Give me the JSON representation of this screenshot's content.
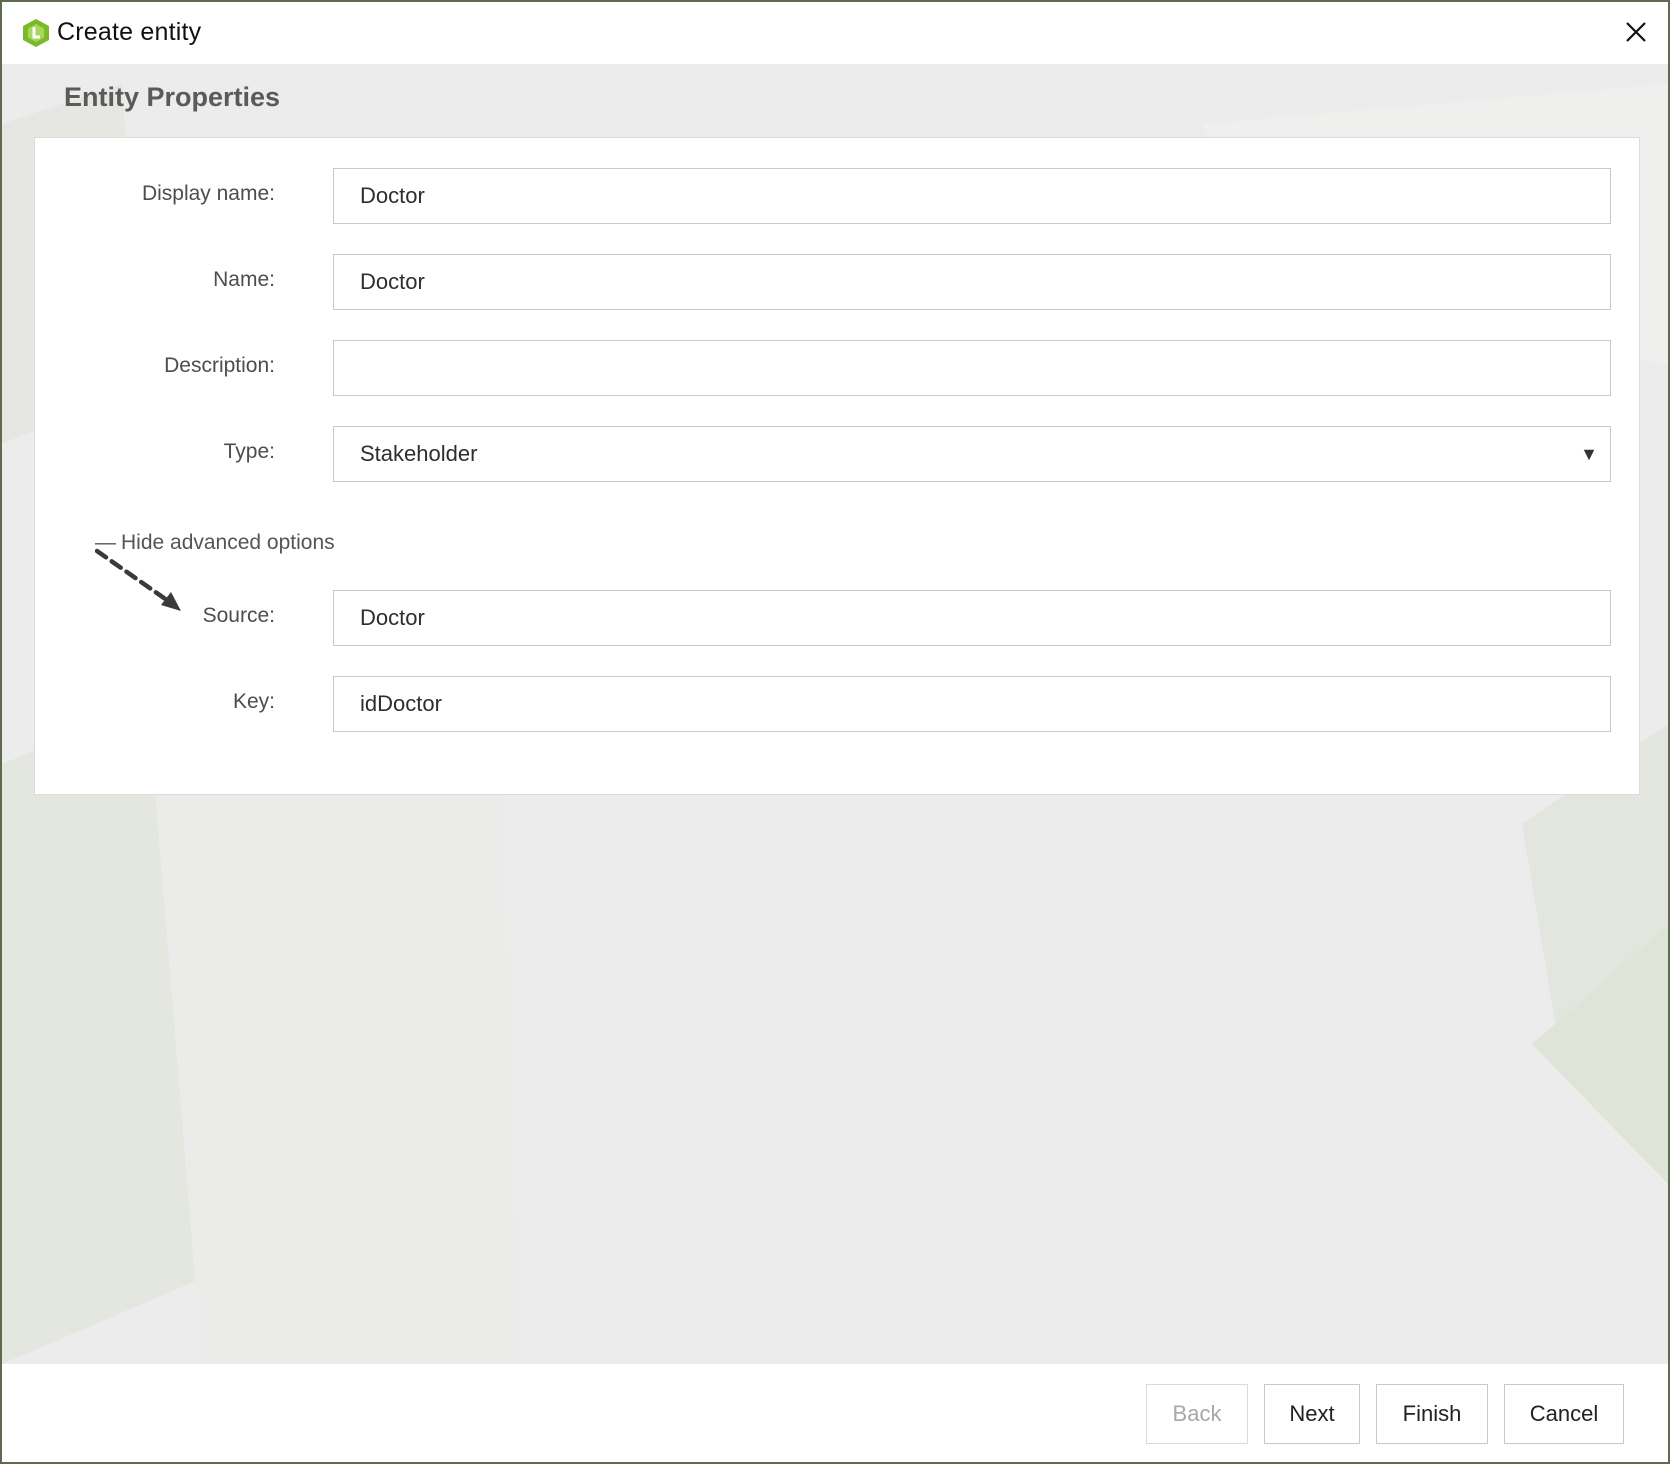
{
  "window": {
    "title": "Create entity",
    "app_icon": "hexagon-app-logo-icon",
    "close_icon": "close-icon"
  },
  "section": {
    "title": "Entity Properties"
  },
  "form": {
    "display_name": {
      "label": "Display name:",
      "value": "Doctor"
    },
    "name": {
      "label": "Name:",
      "value": "Doctor"
    },
    "description": {
      "label": "Description:",
      "value": ""
    },
    "type": {
      "label": "Type:",
      "value": "Stakeholder",
      "arrow": "▼"
    },
    "advanced_toggle": {
      "symbol": "—",
      "label": "Hide advanced options"
    },
    "source": {
      "label": "Source:",
      "value": "Doctor"
    },
    "key": {
      "label": "Key:",
      "value": "idDoctor"
    }
  },
  "footer": {
    "back_label": "Back",
    "next_label": "Next",
    "finish_label": "Finish",
    "cancel_label": "Cancel",
    "back_enabled": false
  },
  "colors": {
    "logo_green": "#7ab929",
    "body_bg": "#ececec",
    "panel_bg": "#ffffff",
    "field_border": "#c9c9c9"
  }
}
